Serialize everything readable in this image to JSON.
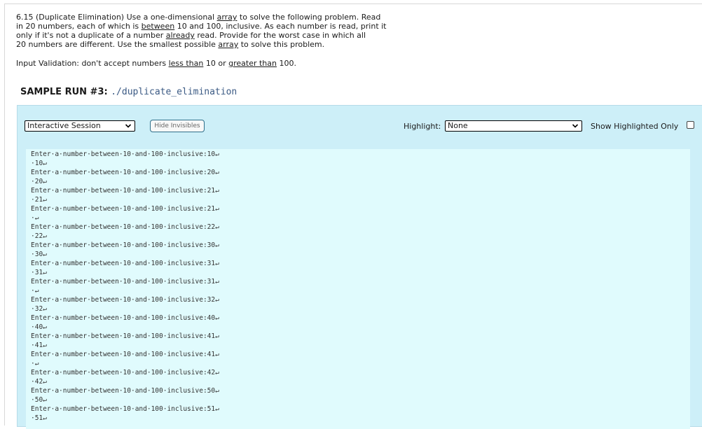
{
  "problem": {
    "lines": [
      [
        {
          "t": "6.15 (Duplicate Elimination) Use a one-dimensional "
        },
        {
          "t": "array",
          "u": true
        },
        {
          "t": " to solve the following problem. Read"
        }
      ],
      [
        {
          "t": "in 20 numbers, each of which is "
        },
        {
          "t": "between",
          "u": true
        },
        {
          "t": " 10 and 100, inclusive. As each number is read, print it"
        }
      ],
      [
        {
          "t": "only if it's not a duplicate of a number "
        },
        {
          "t": "already",
          "u": true
        },
        {
          "t": " read. Provide for the worst case in which all"
        }
      ],
      [
        {
          "t": "20 numbers are different. Use the smallest possible "
        },
        {
          "t": "array",
          "u": true
        },
        {
          "t": " to solve this problem."
        }
      ]
    ]
  },
  "validation": {
    "prefix": "Input Validation: don't accept numbers ",
    "less_than": "less than",
    "middle": " 10 or ",
    "greater_than": "greater than",
    "suffix": " 100."
  },
  "run": {
    "label": "SAMPLE RUN #3: ",
    "command": "./duplicate_elimination"
  },
  "toolbar": {
    "session_value": "Interactive Session",
    "hide_invisibles": "Hide Invisibles",
    "highlight_label": "Highlight:",
    "highlight_value": "None",
    "show_highlighted_only": "Show Highlighted Only"
  },
  "console": {
    "lines": [
      "Enter·a·number·between·10·and·100·inclusive:10↵",
      "·10↵",
      "Enter·a·number·between·10·and·100·inclusive:20↵",
      "·20↵",
      "Enter·a·number·between·10·and·100·inclusive:21↵",
      "·21↵",
      "Enter·a·number·between·10·and·100·inclusive:21↵",
      "·↵",
      "Enter·a·number·between·10·and·100·inclusive:22↵",
      "·22↵",
      "Enter·a·number·between·10·and·100·inclusive:30↵",
      "·30↵",
      "Enter·a·number·between·10·and·100·inclusive:31↵",
      "·31↵",
      "Enter·a·number·between·10·and·100·inclusive:31↵",
      "·↵",
      "Enter·a·number·between·10·and·100·inclusive:32↵",
      "·32↵",
      "Enter·a·number·between·10·and·100·inclusive:40↵",
      "·40↵",
      "Enter·a·number·between·10·and·100·inclusive:41↵",
      "·41↵",
      "Enter·a·number·between·10·and·100·inclusive:41↵",
      "·↵",
      "Enter·a·number·between·10·and·100·inclusive:42↵",
      "·42↵",
      "Enter·a·number·between·10·and·100·inclusive:50↵",
      "·50↵",
      "Enter·a·number·between·10·and·100·inclusive:51↵",
      "·51↵"
    ]
  },
  "colors": {
    "panel_bg": "#cdeff8",
    "console_bg": "#e0fbfd",
    "command_text": "#3b5a84"
  }
}
